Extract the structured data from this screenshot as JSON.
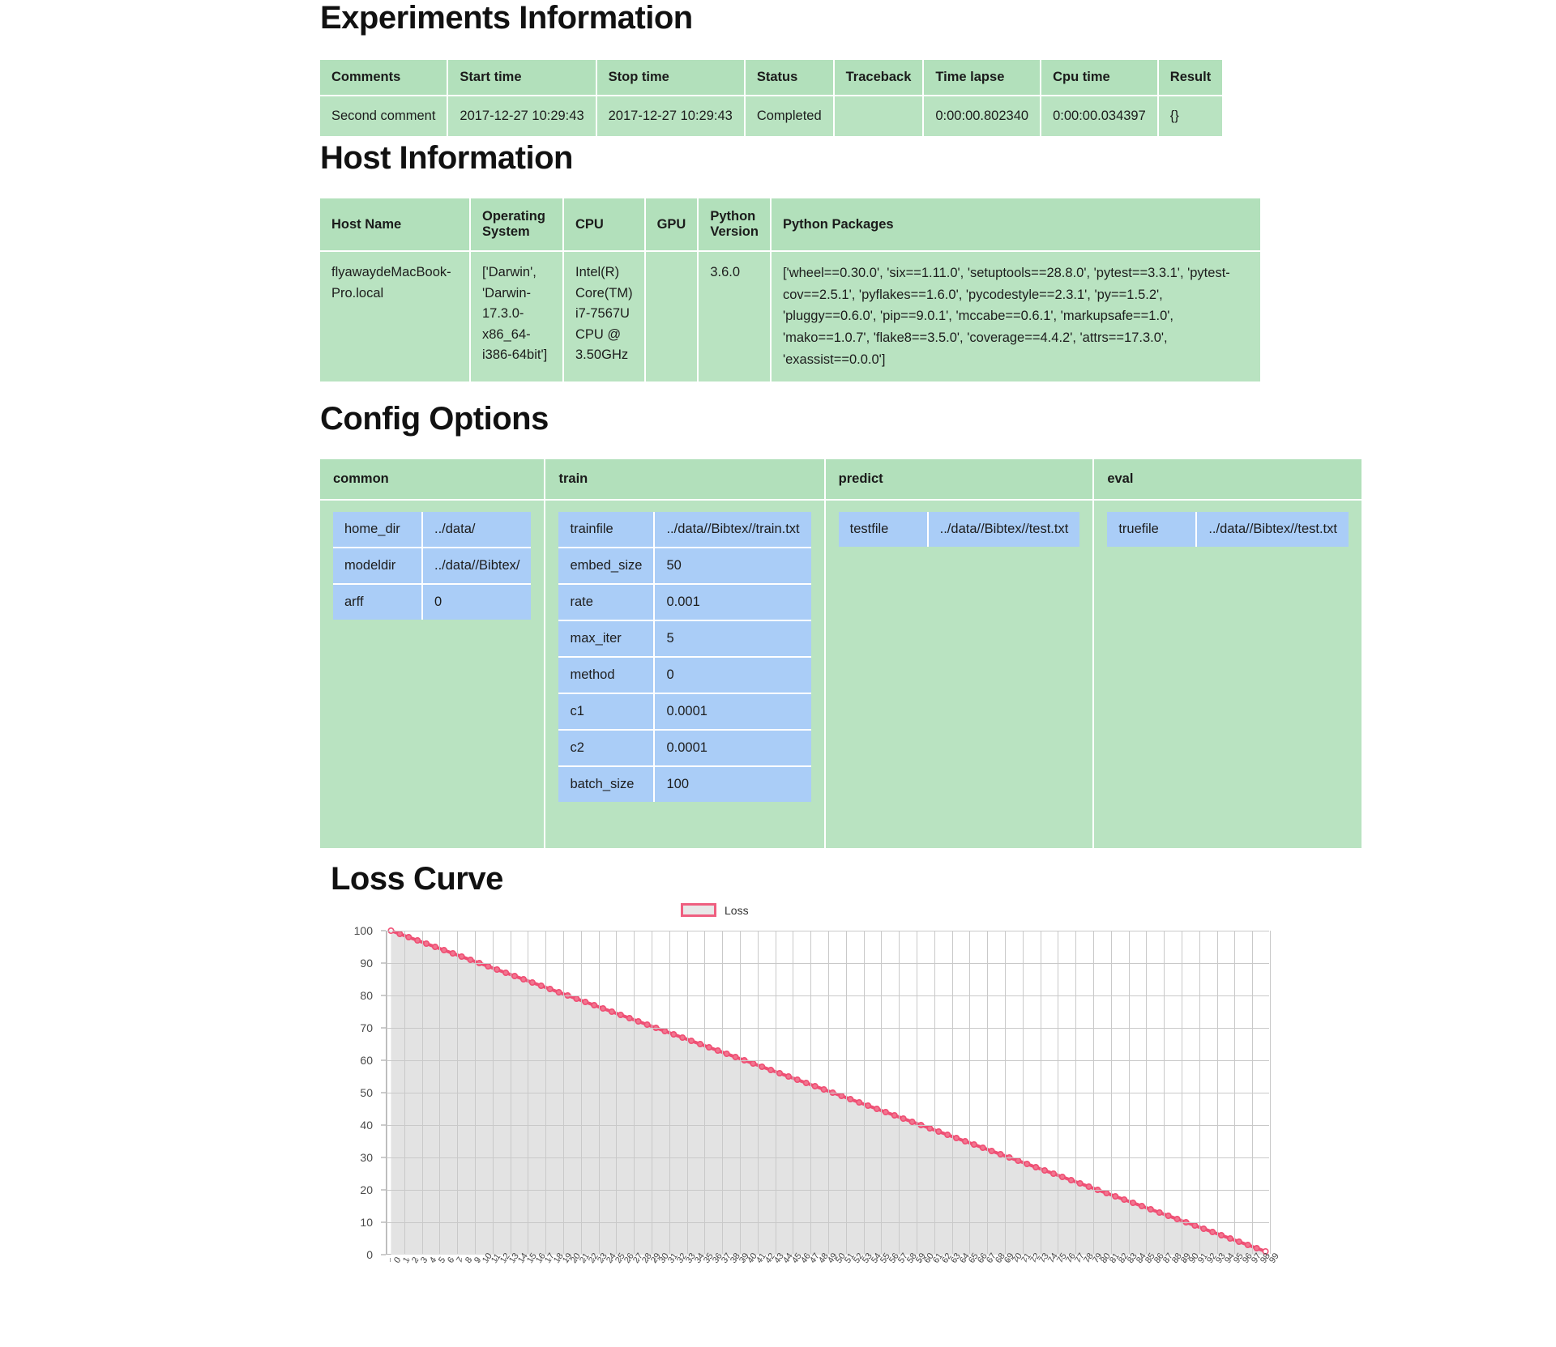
{
  "experiments": {
    "title": "Experiments Information",
    "columns": [
      "Comments",
      "Start time",
      "Stop time",
      "Status",
      "Traceback",
      "Time lapse",
      "Cpu time",
      "Result"
    ],
    "rows": [
      [
        "Second comment",
        "2017-12-27 10:29:43",
        "2017-12-27 10:29:43",
        "Completed",
        "",
        "0:00:00.802340",
        "0:00:00.034397",
        "{}"
      ]
    ]
  },
  "host": {
    "title": "Host Information",
    "columns": [
      "Host Name",
      "Operating System",
      "CPU",
      "GPU",
      "Python Version",
      "Python Packages"
    ],
    "rows": [
      [
        "flyawaydeMacBook-Pro.local",
        "['Darwin', 'Darwin-17.3.0-x86_64-i386-64bit']",
        "Intel(R) Core(TM) i7-7567U CPU @ 3.50GHz",
        "",
        "3.6.0",
        "['wheel==0.30.0', 'six==1.11.0', 'setuptools==28.8.0', 'pytest==3.3.1', 'pytest-cov==2.5.1', 'pyflakes==1.6.0', 'pycodestyle==2.3.1', 'py==1.5.2', 'pluggy==0.6.0', 'pip==9.0.1', 'mccabe==0.6.1', 'markupsafe==1.0', 'mako==1.0.7', 'flake8==3.5.0', 'coverage==4.4.2', 'attrs==17.3.0', 'exassist==0.0.0']"
      ]
    ]
  },
  "config": {
    "title": "Config Options",
    "groups": [
      {
        "name": "common",
        "options": [
          {
            "key": "home_dir",
            "value": "../data/"
          },
          {
            "key": "modeldir",
            "value": "../data//Bibtex/"
          },
          {
            "key": "arff",
            "value": "0"
          }
        ]
      },
      {
        "name": "train",
        "options": [
          {
            "key": "trainfile",
            "value": "../data//Bibtex//train.txt"
          },
          {
            "key": "embed_size",
            "value": "50"
          },
          {
            "key": "rate",
            "value": "0.001"
          },
          {
            "key": "max_iter",
            "value": "5"
          },
          {
            "key": "method",
            "value": "0"
          },
          {
            "key": "c1",
            "value": "0.0001"
          },
          {
            "key": "c2",
            "value": "0.0001"
          },
          {
            "key": "batch_size",
            "value": "100"
          }
        ]
      },
      {
        "name": "predict",
        "options": [
          {
            "key": "testfile",
            "value": "../data//Bibtex//test.txt"
          }
        ]
      },
      {
        "name": "eval",
        "options": [
          {
            "key": "truefile",
            "value": "../data//Bibtex//test.txt"
          }
        ]
      }
    ]
  },
  "loss": {
    "title": "Loss Curve"
  },
  "chart_data": {
    "type": "line",
    "title": "Loss Curve",
    "xlabel": "",
    "ylabel": "",
    "xlim": [
      0,
      99
    ],
    "ylim": [
      0,
      100
    ],
    "yticks": [
      0,
      10,
      20,
      30,
      40,
      50,
      60,
      70,
      80,
      90,
      100
    ],
    "grid": true,
    "legend_position": "top-center",
    "legend": [
      "Loss"
    ],
    "line_color": "#ef4f74",
    "fill_color": "#e3e3e3",
    "marker": "circle",
    "x": [
      0,
      1,
      2,
      3,
      4,
      5,
      6,
      7,
      8,
      9,
      10,
      11,
      12,
      13,
      14,
      15,
      16,
      17,
      18,
      19,
      20,
      21,
      22,
      23,
      24,
      25,
      26,
      27,
      28,
      29,
      30,
      31,
      32,
      33,
      34,
      35,
      36,
      37,
      38,
      39,
      40,
      41,
      42,
      43,
      44,
      45,
      46,
      47,
      48,
      49,
      50,
      51,
      52,
      53,
      54,
      55,
      56,
      57,
      58,
      59,
      60,
      61,
      62,
      63,
      64,
      65,
      66,
      67,
      68,
      69,
      70,
      71,
      72,
      73,
      74,
      75,
      76,
      77,
      78,
      79,
      80,
      81,
      82,
      83,
      84,
      85,
      86,
      87,
      88,
      89,
      90,
      91,
      92,
      93,
      94,
      95,
      96,
      97,
      98,
      99
    ],
    "series": [
      {
        "name": "Loss",
        "values": [
          100,
          99,
          98,
          97,
          96,
          95,
          94,
          93,
          92,
          91,
          90,
          89,
          88,
          87,
          86,
          85,
          84,
          83,
          82,
          81,
          80,
          79,
          78,
          77,
          76,
          75,
          74,
          73,
          72,
          71,
          70,
          69,
          68,
          67,
          66,
          65,
          64,
          63,
          62,
          61,
          60,
          59,
          58,
          57,
          56,
          55,
          54,
          53,
          52,
          51,
          50,
          49,
          48,
          47,
          46,
          45,
          44,
          43,
          42,
          41,
          40,
          39,
          38,
          37,
          36,
          35,
          34,
          33,
          32,
          31,
          30,
          29,
          28,
          27,
          26,
          25,
          24,
          23,
          22,
          21,
          20,
          19,
          18,
          17,
          16,
          15,
          14,
          13,
          12,
          11,
          10,
          9,
          8,
          7,
          6,
          5,
          4,
          3,
          2,
          1
        ]
      }
    ]
  }
}
